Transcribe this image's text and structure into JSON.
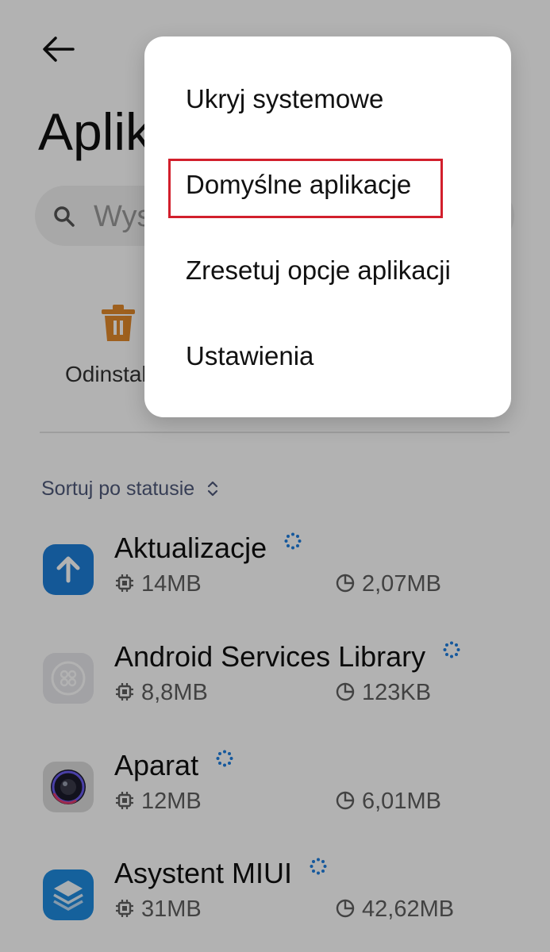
{
  "header": {
    "back_icon": "arrow-left-icon",
    "title": "Aplikacje"
  },
  "search": {
    "placeholder": "Wyszukaj aplikacje",
    "icon": "search-icon"
  },
  "actions": {
    "uninstall_label": "Odinstaluj",
    "uninstall_icon": "trash-icon",
    "uninstall_color": "#E38A2C"
  },
  "list": {
    "sort_label": "Sortuj po statusie",
    "apps": [
      {
        "name": "Aktualizacje",
        "ram": "14MB",
        "storage": "2,07MB",
        "icon": "update-arrow-icon"
      },
      {
        "name": "Android Services Library",
        "ram": "8,8MB",
        "storage": "123KB",
        "icon": "android-library-icon"
      },
      {
        "name": "Aparat",
        "ram": "12MB",
        "storage": "6,01MB",
        "icon": "camera-icon"
      },
      {
        "name": "Asystent MIUI",
        "ram": "31MB",
        "storage": "42,62MB",
        "icon": "layers-icon"
      }
    ]
  },
  "menu": {
    "items": [
      {
        "label": "Ukryj systemowe"
      },
      {
        "label": "Domyślne aplikacje",
        "highlighted": true
      },
      {
        "label": "Zresetuj opcje aplikacji"
      },
      {
        "label": "Ustawienia"
      }
    ],
    "highlight_color": "#D21F2C"
  },
  "colors": {
    "accent_blue": "#1F7FE0",
    "dim_overlay": "rgba(0,0,0,0.30)"
  }
}
